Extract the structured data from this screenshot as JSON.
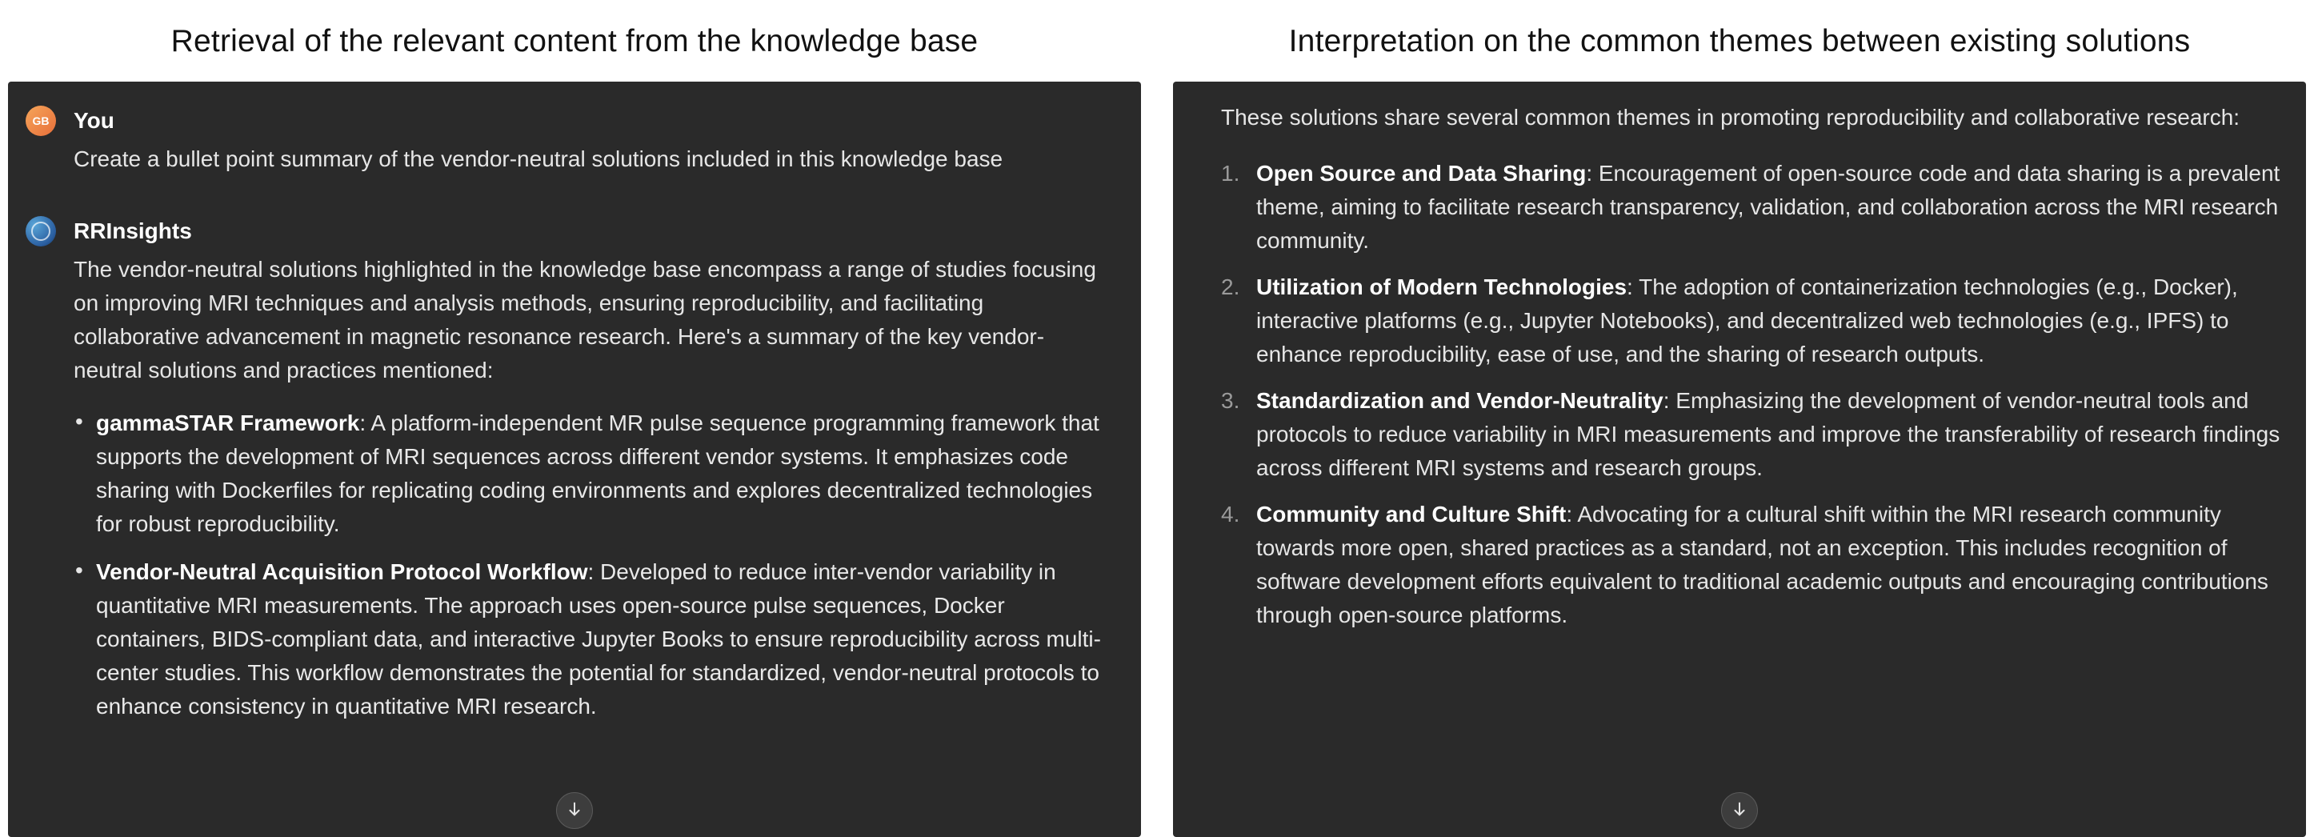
{
  "left": {
    "title": "Retrieval of the relevant content from the knowledge base",
    "user": {
      "avatar_initials": "GB",
      "name": "You",
      "prompt": "Create a bullet point summary of the vendor-neutral solutions included in this knowledge base"
    },
    "bot": {
      "name": "RRInsights",
      "intro": "The vendor-neutral solutions highlighted in the knowledge base encompass a range of studies focusing on improving MRI techniques and analysis methods, ensuring reproducibility, and facilitating collaborative advancement in magnetic resonance research. Here's a summary of the key vendor-neutral solutions and practices mentioned:",
      "bullets": [
        {
          "title": "gammaSTAR Framework",
          "desc": ": A platform-independent MR pulse sequence programming framework that supports the development of MRI sequences across different vendor systems. It emphasizes code sharing with Dockerfiles for replicating coding environments and explores decentralized technologies for robust reproducibility."
        },
        {
          "title": "Vendor-Neutral Acquisition Protocol Workflow",
          "desc": ": Developed to reduce inter-vendor variability in quantitative MRI measurements. The approach uses open-source pulse sequences, Docker containers, BIDS-compliant data, and interactive Jupyter Books to ensure reproducibility across multi-center studies. This workflow demonstrates the potential for standardized, vendor-neutral protocols to enhance consistency in quantitative MRI research."
        }
      ]
    }
  },
  "right": {
    "title": "Interpretation on the common themes between existing solutions",
    "intro": "These solutions share several common themes in promoting reproducibility and collaborative research:",
    "themes": [
      {
        "title": "Open Source and Data Sharing",
        "desc": ": Encouragement of open-source code and data sharing is a prevalent theme, aiming to facilitate research transparency, validation, and collaboration across the MRI research community."
      },
      {
        "title": "Utilization of Modern Technologies",
        "desc": ": The adoption of containerization technologies (e.g., Docker), interactive platforms (e.g., Jupyter Notebooks), and decentralized web technologies (e.g., IPFS) to enhance reproducibility, ease of use, and the sharing of research outputs."
      },
      {
        "title": "Standardization and Vendor-Neutrality",
        "desc": ": Emphasizing the development of vendor-neutral tools and protocols to reduce variability in MRI measurements and improve the transferability of research findings across different MRI systems and research groups."
      },
      {
        "title": "Community and Culture Shift",
        "desc": ": Advocating for a cultural shift within the MRI research community towards more open, shared practices as a standard, not an exception. This includes recognition of software development efforts equivalent to traditional academic outputs and encouraging contributions through open-source platforms."
      }
    ]
  }
}
